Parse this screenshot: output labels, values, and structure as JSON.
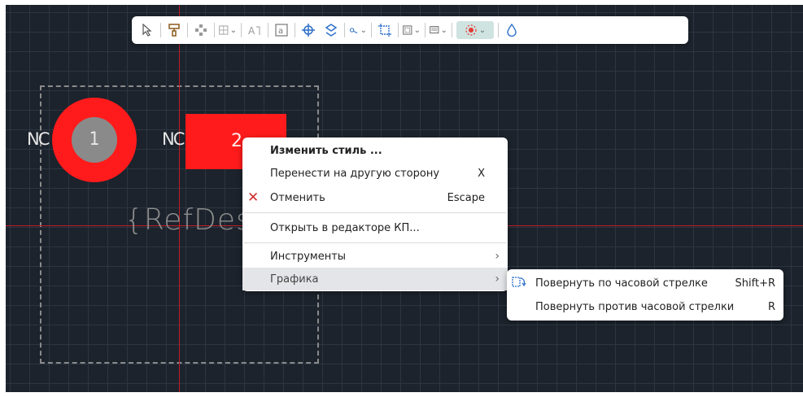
{
  "toolbar": {
    "tools": [
      "select-icon",
      "paint-icon",
      "distribute-icon",
      "grid-icon",
      "text-icon",
      "textbox-icon",
      "crosshair-icon",
      "swap-layers-icon",
      "measure-icon",
      "resize-icon",
      "frame-icon",
      "display-icon",
      "highlight-icon",
      "drop-icon"
    ]
  },
  "board": {
    "pad1": {
      "label": "1",
      "net": "NC"
    },
    "pad2": {
      "label": "2",
      "net": "NC"
    },
    "refdes": "{RefDes}",
    "colors": {
      "background": "#1c232c",
      "pad": "#ff1b1b",
      "crosshair": "#c21d29",
      "courtyard": "#8a8a8a"
    }
  },
  "context_menu": {
    "items": [
      {
        "label": "Изменить стиль ...",
        "shortcut": "",
        "bold": true
      },
      {
        "label": "Перенести на другую сторону",
        "shortcut": "X"
      },
      {
        "label": "Отменить",
        "shortcut": "Escape",
        "icon": "x-icon"
      },
      {
        "label": "Открыть в редакторе КП...",
        "shortcut": ""
      },
      {
        "label": "Инструменты",
        "submenu": true
      },
      {
        "label": "Графика",
        "submenu": true,
        "highlighted": true
      }
    ]
  },
  "submenu": {
    "items": [
      {
        "label": "Повернуть по часовой стрелке",
        "shortcut": "Shift+R",
        "icon": "rotate-clockwise-icon"
      },
      {
        "label": "Повернуть против часовой стрелки",
        "shortcut": "R"
      }
    ]
  }
}
